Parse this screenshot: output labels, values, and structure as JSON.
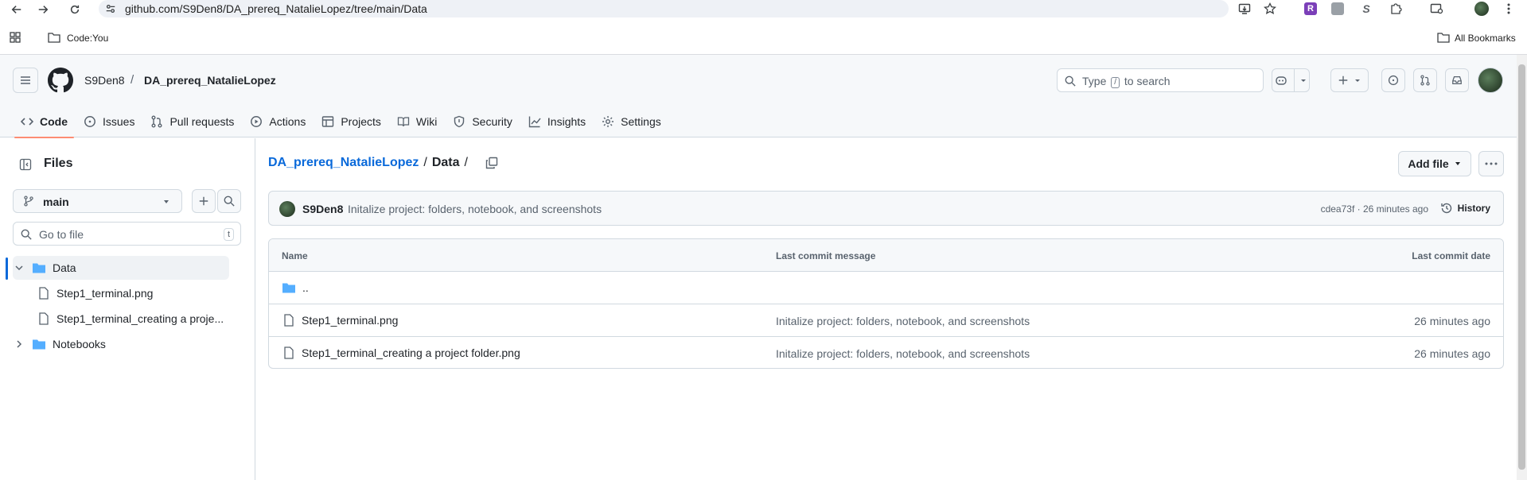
{
  "browser": {
    "url": "github.com/S9Den8/DA_prereq_NatalieLopez/tree/main/Data",
    "bookmark_folder": "Code:You",
    "all_bookmarks": "All Bookmarks",
    "ext_r": "R",
    "ext_s": "S"
  },
  "header": {
    "owner": "S9Den8",
    "separator": "/",
    "repo": "DA_prereq_NatalieLopez",
    "search_type": "Type",
    "search_key": "/",
    "search_rest": "to search"
  },
  "tabs": [
    {
      "label": "Code",
      "icon": "code-icon"
    },
    {
      "label": "Issues",
      "icon": "issue-icon"
    },
    {
      "label": "Pull requests",
      "icon": "pull-request-icon"
    },
    {
      "label": "Actions",
      "icon": "play-icon"
    },
    {
      "label": "Projects",
      "icon": "table-icon"
    },
    {
      "label": "Wiki",
      "icon": "book-icon"
    },
    {
      "label": "Security",
      "icon": "shield-icon"
    },
    {
      "label": "Insights",
      "icon": "graph-icon"
    },
    {
      "label": "Settings",
      "icon": "gear-icon"
    }
  ],
  "sidebar": {
    "title": "Files",
    "branch": "main",
    "goto_placeholder": "Go to file",
    "goto_key": "t",
    "tree": [
      {
        "label": "Data",
        "type": "folder",
        "expanded": true
      },
      {
        "label": "Step1_terminal.png",
        "type": "file"
      },
      {
        "label": "Step1_terminal_creating a proje...",
        "type": "file"
      },
      {
        "label": "Notebooks",
        "type": "folder",
        "expanded": false
      }
    ]
  },
  "main": {
    "breadcrumb_repo": "DA_prereq_NatalieLopez",
    "breadcrumb_sep": "/",
    "breadcrumb_current": "Data",
    "breadcrumb_trail": "/",
    "add_file": "Add file",
    "commit": {
      "author": "S9Den8",
      "message": "Initalize project: folders, notebook, and screenshots",
      "meta": "cdea73f · 26 minutes ago",
      "history": "History"
    },
    "table": {
      "headers": [
        "Name",
        "Last commit message",
        "Last commit date"
      ],
      "parent": "..",
      "rows": [
        {
          "name": "Step1_terminal.png",
          "message": "Initalize project: folders, notebook, and screenshots",
          "date": "26 minutes ago"
        },
        {
          "name": "Step1_terminal_creating a project folder.png",
          "message": "Initalize project: folders, notebook, and screenshots",
          "date": "26 minutes ago"
        }
      ]
    }
  },
  "colors": {
    "accent": "#0969da",
    "tab_underline": "#fd8c73",
    "folder": "#54aeff"
  }
}
